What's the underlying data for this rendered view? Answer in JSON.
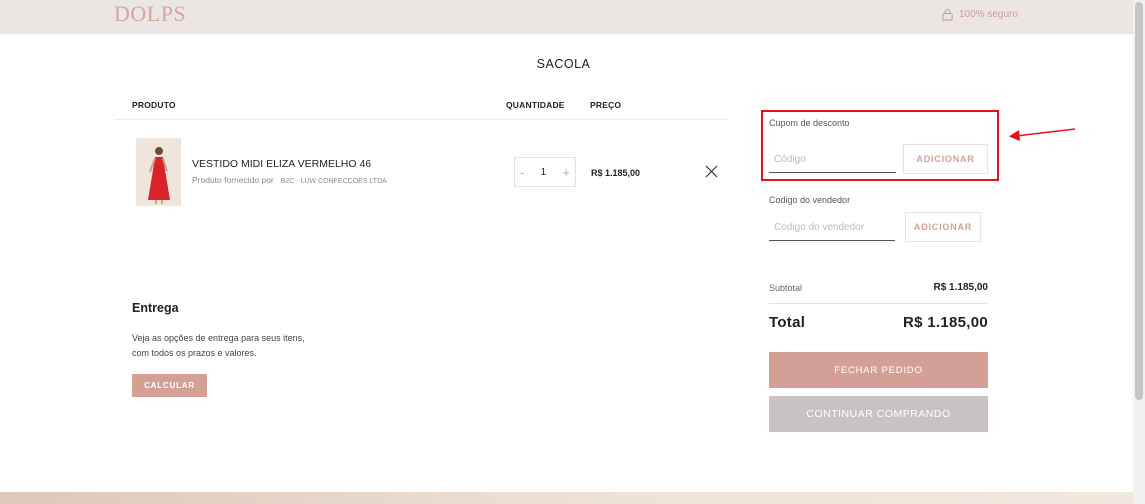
{
  "header": {
    "logo": "DOLPS",
    "secure_label": "100% seguro"
  },
  "page_title": "SACOLA",
  "columns": {
    "product": "PRODUTO",
    "quantity": "QUANTIDADE",
    "price": "PREÇO"
  },
  "cart": {
    "items": [
      {
        "name": "VESTIDO MIDI ELIZA VERMELHO 46",
        "supplier_label": "Produto fornecido por",
        "vendor": "B2C - LUW CONFECCOES LTDA",
        "quantity": "1",
        "price": "R$ 1.185,00",
        "qty_decrease": "-",
        "qty_increase": "+"
      }
    ]
  },
  "delivery": {
    "title": "Entrega",
    "line1": "Veja as opções de entrega para seus itens,",
    "line2": "com todos os prazos e valores.",
    "button": "CALCULAR"
  },
  "coupon": {
    "label": "Cupom de desconto",
    "placeholder": "Código",
    "button": "ADICIONAR"
  },
  "seller": {
    "label": "Codigo do vendedor",
    "placeholder": "Codigo do vendedor",
    "button": "ADICIONAR"
  },
  "summary": {
    "subtotal_label": "Subtotal",
    "subtotal_value": "R$ 1.185,00",
    "total_label": "Total",
    "total_value": "R$ 1.185,00"
  },
  "actions": {
    "checkout": "FECHAR PEDIDO",
    "continue": "CONTINUAR COMPRANDO"
  },
  "colors": {
    "accent": "#d4a096",
    "header_bg": "#ebe6e3",
    "highlight": "#e5111c",
    "secondary_button": "#c8c2c3"
  },
  "icons": {
    "secure": "lock-icon",
    "remove": "close-icon",
    "annotation": "arrow-left-icon"
  }
}
